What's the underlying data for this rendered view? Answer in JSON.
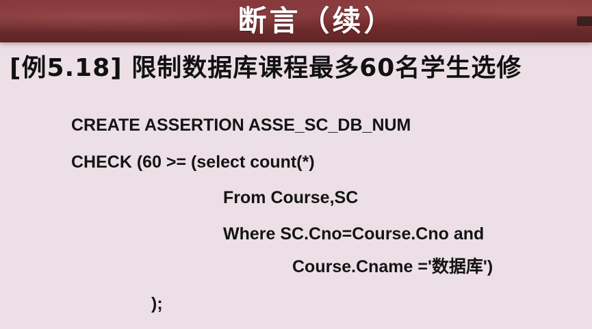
{
  "slide": {
    "title": "断言（续）",
    "heading": "[例5.18] 限制数据库课程最多60名学生选修"
  },
  "code": {
    "lines": [
      "CREATE ASSERTION ASSE_SC_DB_NUM",
      "CHECK (60 >= (select count(*)",
      "From Course,SC",
      "Where SC.Cno=Course.Cno and",
      "Course.Cname ='数据库')",
      ");"
    ]
  },
  "colors": {
    "title_band": "#6e2b2e",
    "background": "#ecdfe6",
    "text": "#141414"
  }
}
